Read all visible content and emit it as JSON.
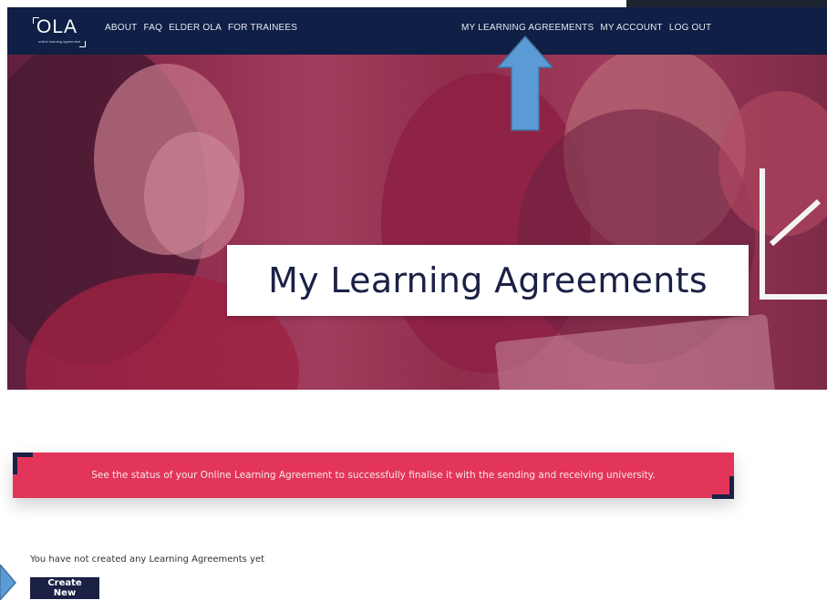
{
  "logo": {
    "text": "OLA",
    "tagline": "online learning agreement",
    "icon": "ola-logo"
  },
  "nav": {
    "left": [
      {
        "label": "ABOUT"
      },
      {
        "label": "FAQ"
      },
      {
        "label": "ELDER OLA"
      },
      {
        "label": "FOR TRAINEES"
      }
    ],
    "right": [
      {
        "label": "MY LEARNING AGREEMENTS"
      },
      {
        "label": "MY ACCOUNT"
      },
      {
        "label": "LOG OUT"
      }
    ]
  },
  "hero": {
    "title": "My Learning Agreements"
  },
  "banner": {
    "text": "See the status of your Online Learning Agreement to successfully finalise it with the sending and receiving university."
  },
  "content": {
    "empty_message": "You have not created any Learning Agreements yet",
    "create_button": "Create New"
  },
  "colors": {
    "navbar": "#0f1f45",
    "banner": "#e33559",
    "dark_accent": "#1b2145",
    "annotation_arrow": "#5b9bd5"
  },
  "annotations": {
    "arrow_up_icon": "arrow-up-icon",
    "arrow_right_icon": "arrow-right-icon"
  }
}
